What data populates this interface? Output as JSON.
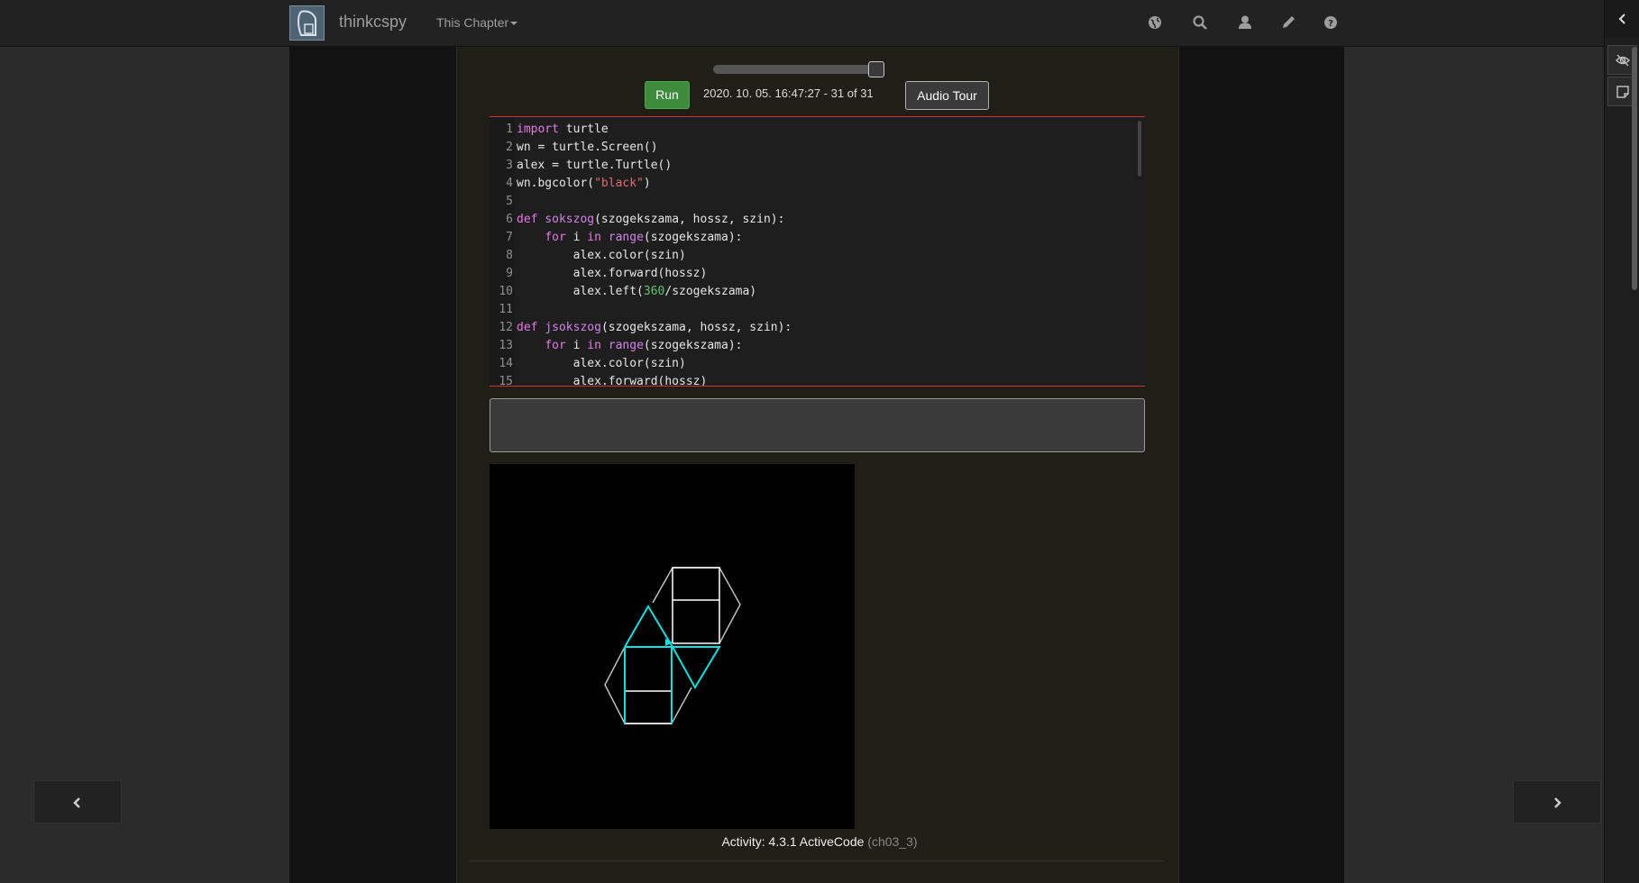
{
  "navbar": {
    "brand": "thinkcspy",
    "chapter_menu": "This Chapter",
    "icons": [
      "globe-icon",
      "search-icon",
      "user-icon",
      "pencil-icon",
      "help-icon"
    ]
  },
  "history": {
    "timestamp": "2020. 10. 05. 16:47:27 - 31 of 31",
    "position": 1.0
  },
  "toolbar": {
    "run_label": "Run",
    "audio_label": "Audio Tour"
  },
  "code": {
    "lines": [
      {
        "n": "1"
      },
      {
        "n": "2"
      },
      {
        "n": "3"
      },
      {
        "n": "4"
      },
      {
        "n": "5"
      },
      {
        "n": "6"
      },
      {
        "n": "7"
      },
      {
        "n": "8"
      },
      {
        "n": "9"
      },
      {
        "n": "10"
      },
      {
        "n": "11"
      },
      {
        "n": "12"
      },
      {
        "n": "13"
      },
      {
        "n": "14"
      },
      {
        "n": "15"
      }
    ],
    "segments": {
      "l1_kw": "import",
      "l1_rest": " turtle",
      "l2": "wn = turtle.Screen()",
      "l3": "alex = turtle.Turtle()",
      "l4_a": "wn.bgcolor(",
      "l4_str": "\"black\"",
      "l4_b": ")",
      "l6_kw": "def",
      "l6_fn": "sokszog",
      "l6_rest": "(szogekszama, hossz, szin):",
      "l7_ind": "    ",
      "l7_for": "for",
      "l7_i": " i ",
      "l7_in": "in",
      "l7_sp": " ",
      "l7_range": "range",
      "l7_rest": "(szogekszama):",
      "l8": "        alex.color(szin)",
      "l9": "        alex.forward(hossz)",
      "l10_a": "        alex.left(",
      "l10_num": "360",
      "l10_b": "/szogekszama)",
      "l12_kw": "def",
      "l12_fn": "jsokszog",
      "l12_rest": "(szogekszama, hossz, szin):",
      "l13_ind": "    ",
      "l13_for": "for",
      "l13_i": " i ",
      "l13_in": "in",
      "l13_sp": " ",
      "l13_range": "range",
      "l13_rest": "(szogekszama):",
      "l14": "        alex.color(szin)",
      "l15": "        alex.forward(hossz)"
    }
  },
  "output": {
    "text": ""
  },
  "caption": {
    "label": "Activity: 4.3.1 ActiveCode",
    "id": "(ch03_3)"
  },
  "colors": {
    "turtle_cyan": "#00e5e5",
    "turtle_white": "#ffffff",
    "turtle_gray": "#bfbfbf",
    "run_green": "#3c8c3c"
  }
}
